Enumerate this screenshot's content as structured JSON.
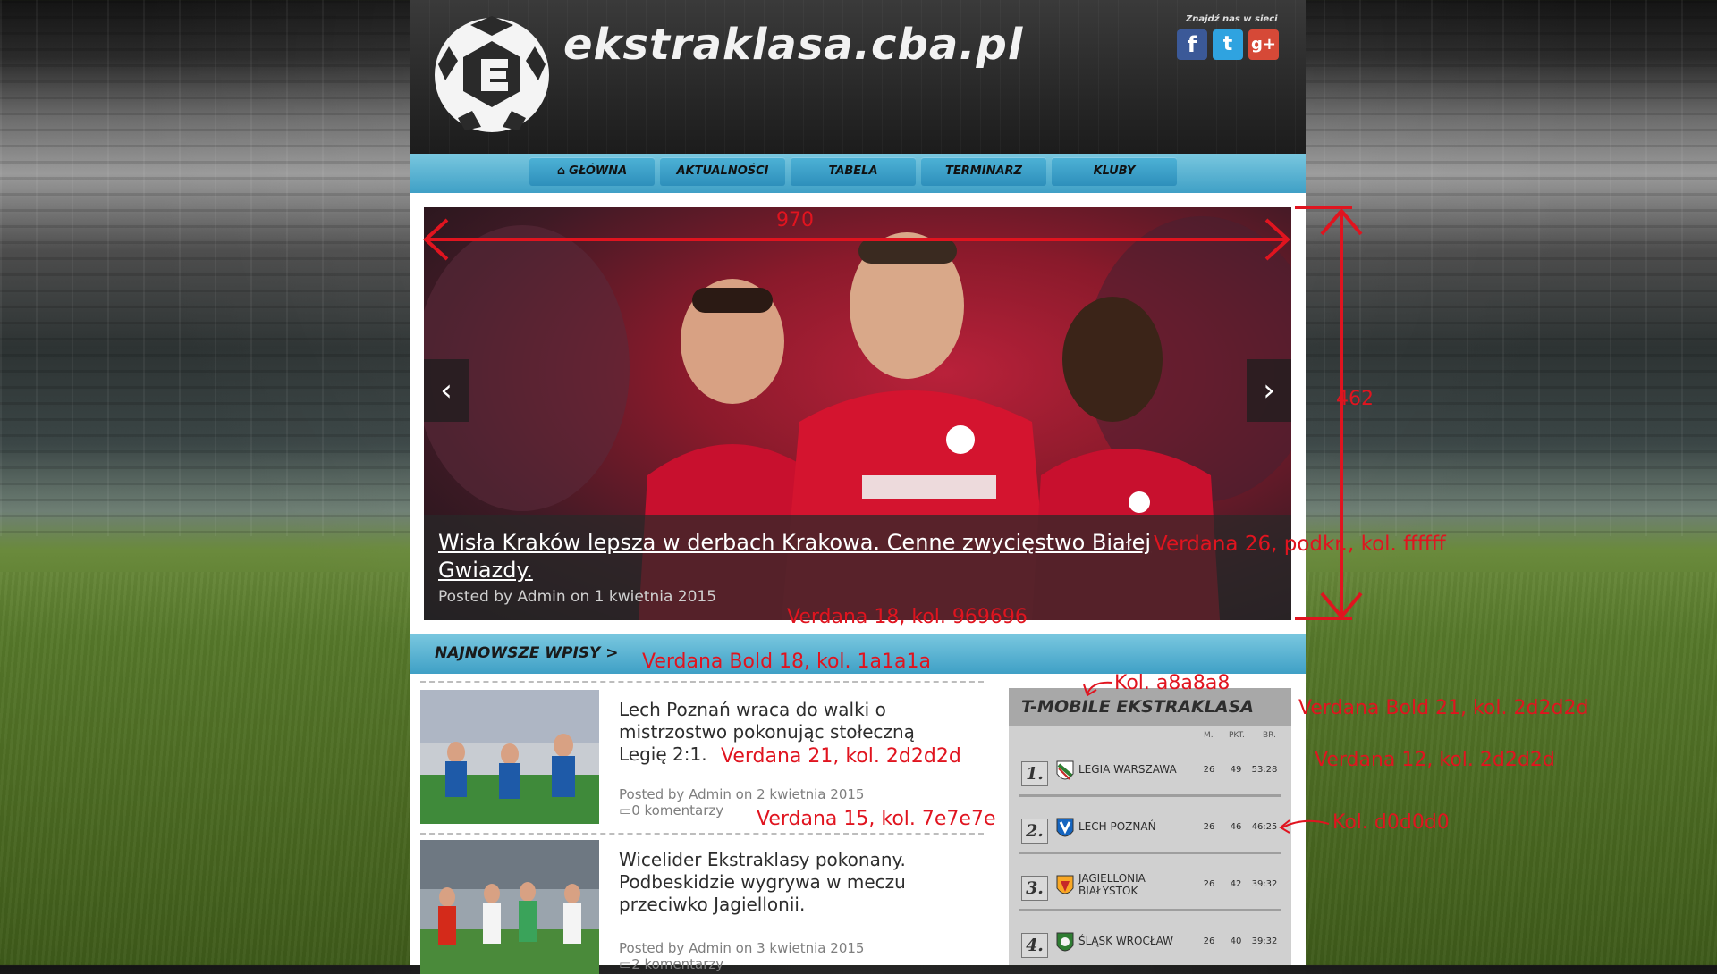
{
  "header": {
    "site_title": "ekstraklasa.cba.pl",
    "social_label": "Znajdź nas w sieci",
    "social": [
      {
        "name": "facebook-icon",
        "glyph": "f"
      },
      {
        "name": "twitter-icon",
        "glyph": "t"
      },
      {
        "name": "googleplus-icon",
        "glyph": "g+"
      }
    ]
  },
  "nav": {
    "items": [
      {
        "label": "GŁÓWNA",
        "icon": "home-icon"
      },
      {
        "label": "AKTUALNOŚCI"
      },
      {
        "label": "TABELA"
      },
      {
        "label": "TERMINARZ"
      },
      {
        "label": "KLUBY"
      }
    ]
  },
  "slider": {
    "prev_glyph": "‹",
    "next_glyph": "›",
    "title": "Wisła Kraków lepsza w derbach Krakowa. Cenne zwycięstwo Białej Gwiazdy.",
    "meta": "Posted by Admin on 1 kwietnia 2015"
  },
  "section": {
    "title": "NAJNOWSZE WPISY >"
  },
  "posts": [
    {
      "title": "Lech Poznań wraca do walki o mistrzostwo pokonując stołeczną Legię 2:1.",
      "meta": "Posted by Admin on 2 kwietnia 2015",
      "comments": "0 komentarzy"
    },
    {
      "title": "Wicelider Ekstraklasy pokonany. Podbeskidzie wygrywa w meczu przeciwko Jagiellonii.",
      "meta": "Posted by Admin on 3 kwietnia 2015",
      "comments": "2 komentarzy"
    }
  ],
  "league": {
    "title": "T-MOBILE EKSTRAKLASA",
    "columns": [
      "M.",
      "PKT.",
      "BR."
    ],
    "rows": [
      {
        "pos": "1.",
        "team": "LEGIA WARSZAWA",
        "m": "26",
        "pkt": "49",
        "br": "53:28",
        "crest_color": "#2e7d32"
      },
      {
        "pos": "2.",
        "team": "LECH POZNAŃ",
        "m": "26",
        "pkt": "46",
        "br": "46:25",
        "crest_color": "#1565c0"
      },
      {
        "pos": "3.",
        "team": "JAGIELLONIA BIAŁYSTOK",
        "m": "26",
        "pkt": "42",
        "br": "39:32",
        "crest_color": "#f9a825"
      },
      {
        "pos": "4.",
        "team": "ŚLĄSK WROCŁAW",
        "m": "26",
        "pkt": "40",
        "br": "39:32",
        "crest_color": "#2e7d32"
      }
    ]
  },
  "annotations": {
    "width": "970",
    "height": "462",
    "slide_title_spec": "Verdana 26, podkr., kol. ffffff",
    "slide_meta_spec": "Verdana 18, kol. 969696",
    "section_spec": "Verdana Bold 18, kol. 1a1a1a",
    "league_head_spec": "Kol. a8a8a8",
    "league_title_spec": "Verdana Bold 21, kol. 2d2d2d",
    "post_title_spec": "Verdana 21, kol. 2d2d2d",
    "league_row_spec": "Verdana 12, kol. 2d2d2d",
    "post_meta_spec": "Verdana 15, kol. 7e7e7e",
    "league_bg_spec": "Kol. d0d0d0"
  },
  "colors": {
    "accent": "#3fa0c6",
    "annotation": "#e0141f",
    "slide_title": "#ffffff",
    "slide_meta": "#969696",
    "section_title": "#1a1a1a",
    "post_title": "#2d2d2d",
    "post_meta": "#7e7e7e",
    "league_head": "#a8a8a8",
    "league_bg": "#d0d0d0"
  }
}
